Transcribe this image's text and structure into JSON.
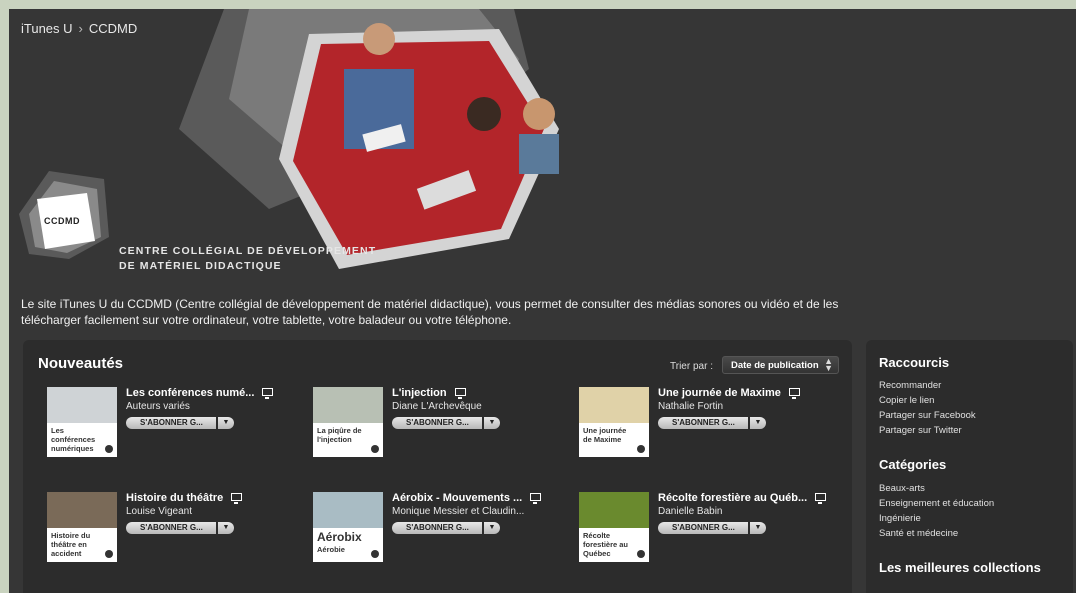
{
  "breadcrumb": {
    "root": "iTunes U",
    "separator": "›",
    "current": "CCDMD"
  },
  "logo": {
    "mark": "CCDMD",
    "line1": "CENTRE COLLÉGIAL DE DÉVELOPPEMENT",
    "line2": "DE MATÉRIEL DIDACTIQUE"
  },
  "intro": "Le site iTunes U du CCDMD (Centre collégial de développement de matériel didactique), vous permet de consulter des médias sonores ou vidéo et de les télécharger facilement sur votre ordinateur, votre tablette, votre baladeur ou votre téléphone.",
  "main": {
    "title": "Nouveautés",
    "sort_label": "Trier par :",
    "sort_value": "Date de publication",
    "subscribe_label": "S'ABONNER G...",
    "subscribe_arrow": "▼",
    "items": [
      {
        "title": "Les conférences numé...",
        "author": "Auteurs variés",
        "thumb_caption": "Les conférences numériques",
        "pic_color": "#cfd3d6"
      },
      {
        "title": "L'injection",
        "author": "Diane L'Archevêque",
        "thumb_caption": "La piqûre de l'injection",
        "pic_color": "#b8c0b4"
      },
      {
        "title": "Une journée de Maxime",
        "author": "Nathalie Fortin",
        "thumb_caption": "Une journée de Maxime",
        "pic_color": "#e0d2a8"
      },
      {
        "title": "Histoire du théâtre",
        "author": "Louise Vigeant",
        "thumb_caption": "Histoire du théâtre en accident",
        "pic_color": "#7a6a58"
      },
      {
        "title": "Aérobix - Mouvements ...",
        "author": "Monique Messier et Claudin...",
        "thumb_caption": "Aérobix",
        "thumb_sub": "Aérobie",
        "pic_color": "#a9bcc4"
      },
      {
        "title": "Récolte forestière au Québ...",
        "author": "Danielle Babin",
        "thumb_caption": "Récolte forestière au Québec",
        "pic_color": "#6a8a2e"
      }
    ]
  },
  "side": {
    "shortcuts_title": "Raccourcis",
    "shortcuts": [
      "Recommander",
      "Copier le lien",
      "Partager sur Facebook",
      "Partager sur Twitter"
    ],
    "categories_title": "Catégories",
    "categories": [
      "Beaux-arts",
      "Enseignement et éducation",
      "Ingénierie",
      "Santé et médecine"
    ],
    "best_title": "Les meilleures collections"
  },
  "colors": {
    "background": "#363636",
    "panel": "#2c2c2c",
    "frame": "#c9d3bf",
    "hero_red": "#b3252a"
  }
}
